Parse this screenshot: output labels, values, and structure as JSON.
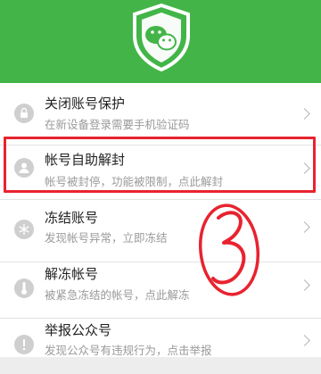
{
  "header": {
    "logo_icon": "wechat-shield-icon",
    "color": "#43b548"
  },
  "menu": {
    "items": [
      {
        "title": "关闭账号保护",
        "subtitle": "在新设备登录需要手机验证码",
        "icon": "lock-icon"
      },
      {
        "title": "帐号自助解封",
        "subtitle": "帐号被封停，功能被限制，点此解封",
        "icon": "user-icon"
      },
      {
        "title": "冻结账号",
        "subtitle": "发现帐号异常，立即冻结",
        "icon": "snowflake-icon"
      },
      {
        "title": "解冻帐号",
        "subtitle": "被紧急冻结的帐号，点此解冻",
        "icon": "thermometer-icon"
      },
      {
        "title": "举报公众号",
        "subtitle": "发现公众号有违规行为，点击举报",
        "icon": "report-icon"
      }
    ]
  },
  "annotation": {
    "highlight_color": "#e8232f",
    "step_number": "3"
  }
}
